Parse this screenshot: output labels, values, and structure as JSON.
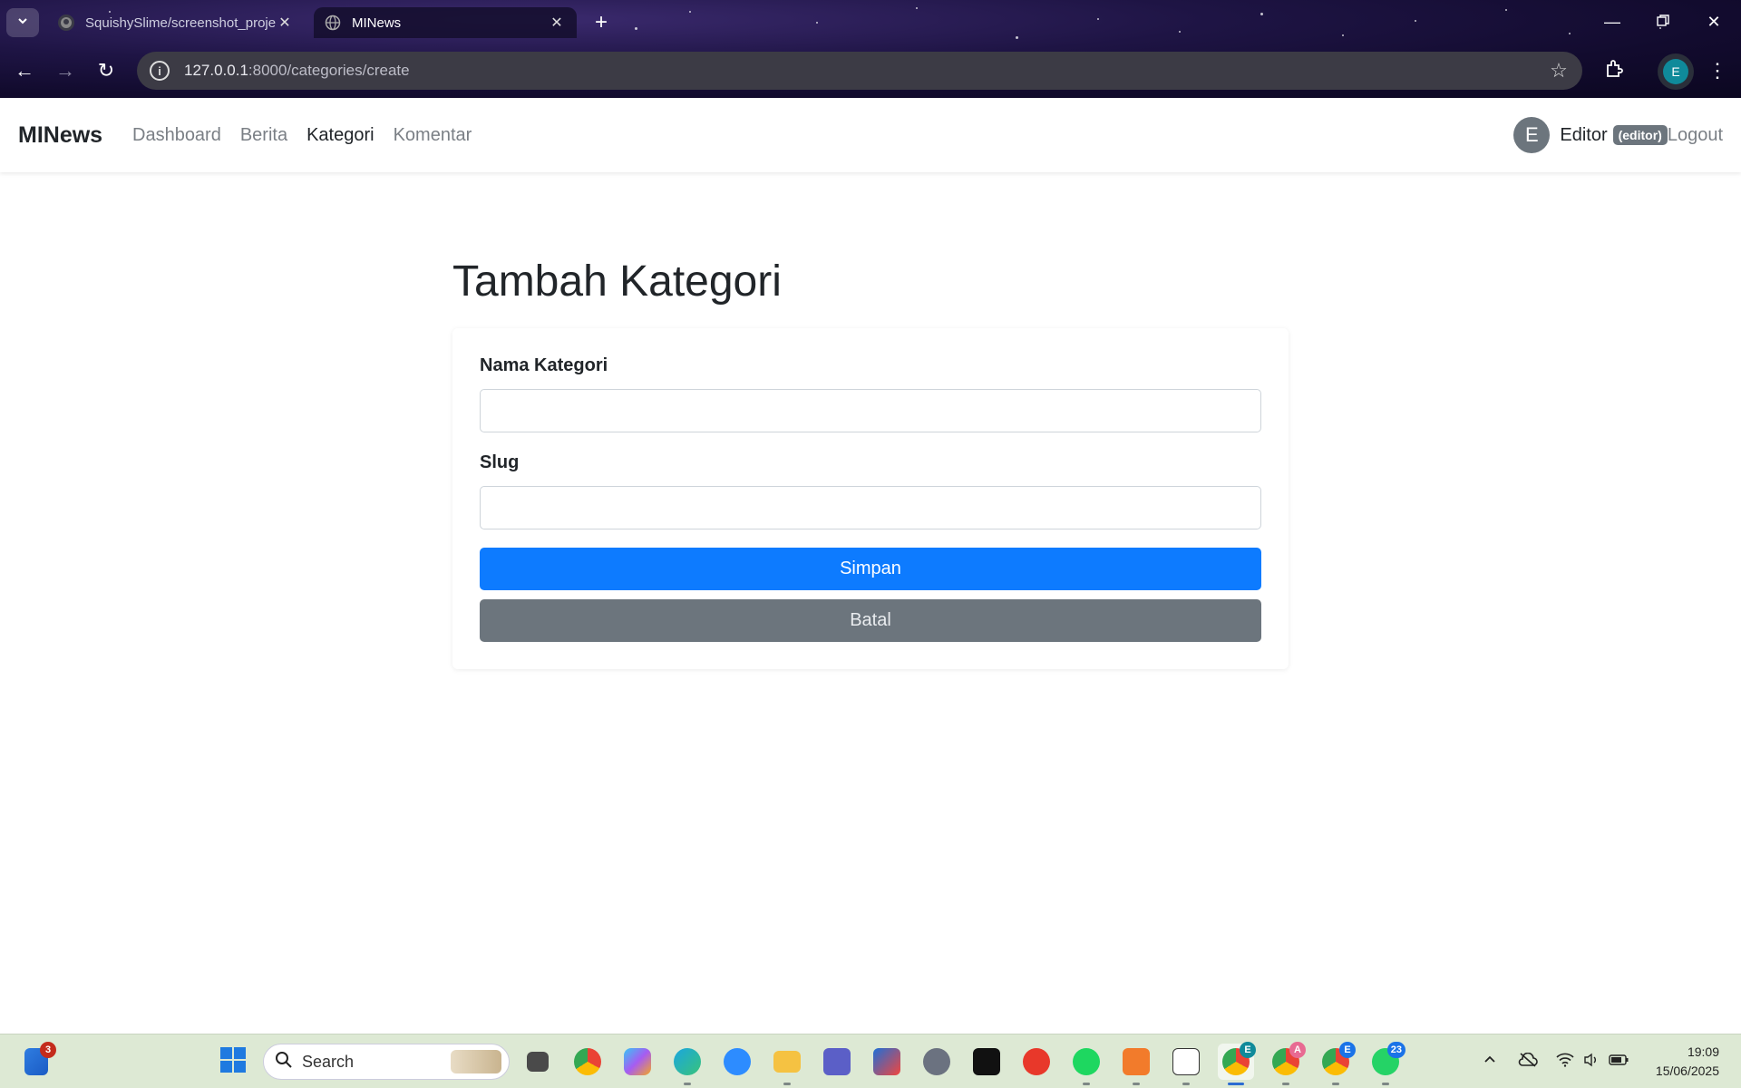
{
  "browser": {
    "tabs": [
      {
        "title": "SquishySlime/screenshot_proje",
        "active": false,
        "icon": "github-icon"
      },
      {
        "title": "MINews",
        "active": true,
        "icon": "globe-icon"
      }
    ],
    "url_host": "127.0.0.1",
    "url_path": ":8000/categories/create",
    "profile_initial": "E"
  },
  "navbar": {
    "brand": "MINews",
    "links": [
      {
        "label": "Dashboard",
        "active": false
      },
      {
        "label": "Berita",
        "active": false
      },
      {
        "label": "Kategori",
        "active": true
      },
      {
        "label": "Komentar",
        "active": false
      }
    ],
    "user": {
      "initial": "E",
      "name": "Editor",
      "role": "(editor)"
    },
    "logout": "Logout"
  },
  "main": {
    "title": "Tambah Kategori",
    "form": {
      "name_label": "Nama Kategori",
      "name_value": "",
      "slug_label": "Slug",
      "slug_value": "",
      "submit_label": "Simpan",
      "cancel_label": "Batal"
    }
  },
  "colors": {
    "primary": "#0d7bff",
    "secondary": "#6c757d",
    "text": "#212529",
    "muted": "#7a7f85"
  },
  "taskbar": {
    "widgets_badge": "3",
    "search_label": "Search",
    "apps": [
      {
        "name": "file-manager-icon"
      },
      {
        "name": "chrome-icon"
      },
      {
        "name": "copilot-icon"
      },
      {
        "name": "edge-icon"
      },
      {
        "name": "zoom-icon"
      },
      {
        "name": "folder-icon"
      },
      {
        "name": "teams-icon"
      },
      {
        "name": "store-icon"
      },
      {
        "name": "settings-icon"
      },
      {
        "name": "paw-icon"
      },
      {
        "name": "wps-icon"
      },
      {
        "name": "spotify-icon"
      },
      {
        "name": "xampp-icon"
      },
      {
        "name": "notion-icon"
      },
      {
        "name": "chrome-profile-e-icon",
        "badge": "E"
      },
      {
        "name": "chrome-profile-a-icon",
        "badge": "A"
      },
      {
        "name": "chrome-profile-e2-icon",
        "badge": "E"
      },
      {
        "name": "whatsapp-icon",
        "badge": "23"
      }
    ],
    "time": "19:09",
    "date": "15/06/2025"
  }
}
